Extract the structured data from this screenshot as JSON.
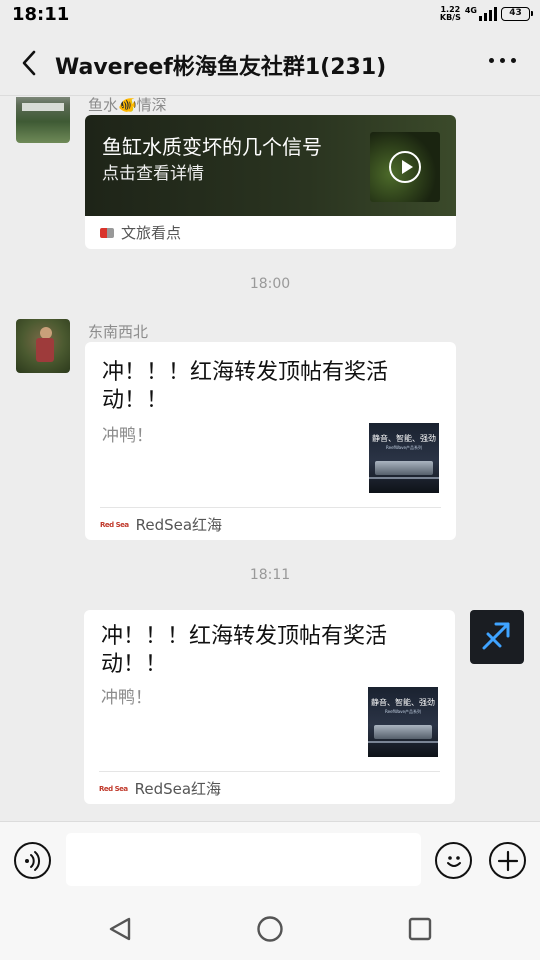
{
  "status_bar": {
    "time": "18:11",
    "net_speed_value": "1.22",
    "net_speed_unit": "KB/S",
    "network_type": "4G",
    "battery": "43"
  },
  "header": {
    "title": "Wavereef彬海鱼友社群1(231)"
  },
  "messages": {
    "msg1": {
      "sender": "鱼水🐠情深",
      "card_title": "鱼缸水质变坏的几个信号",
      "card_subtitle": "点击查看详情",
      "source": "文旅看点"
    },
    "divider1": "18:00",
    "msg2": {
      "sender": "东南西北",
      "card_title": "冲！！！红海转发顶帖有奖活动！！",
      "card_desc": "冲鸭！",
      "thumb_line1": "静音、智能、强劲",
      "thumb_line2": "ReefWave产品系列",
      "source_logo": "Red Sea",
      "source": "RedSea红海"
    },
    "divider2": "18:11",
    "msg3": {
      "card_title": "冲！！！红海转发顶帖有奖活动！！",
      "card_desc": "冲鸭！",
      "thumb_line1": "静音、智能、强劲",
      "thumb_line2": "ReefWave产品系列",
      "source_logo": "Red Sea",
      "source": "RedSea红海"
    }
  },
  "input_bar": {
    "text_value": ""
  },
  "colors": {
    "background": "#ededed",
    "bubble": "#ffffff",
    "meta_text": "#8c8c8c"
  }
}
